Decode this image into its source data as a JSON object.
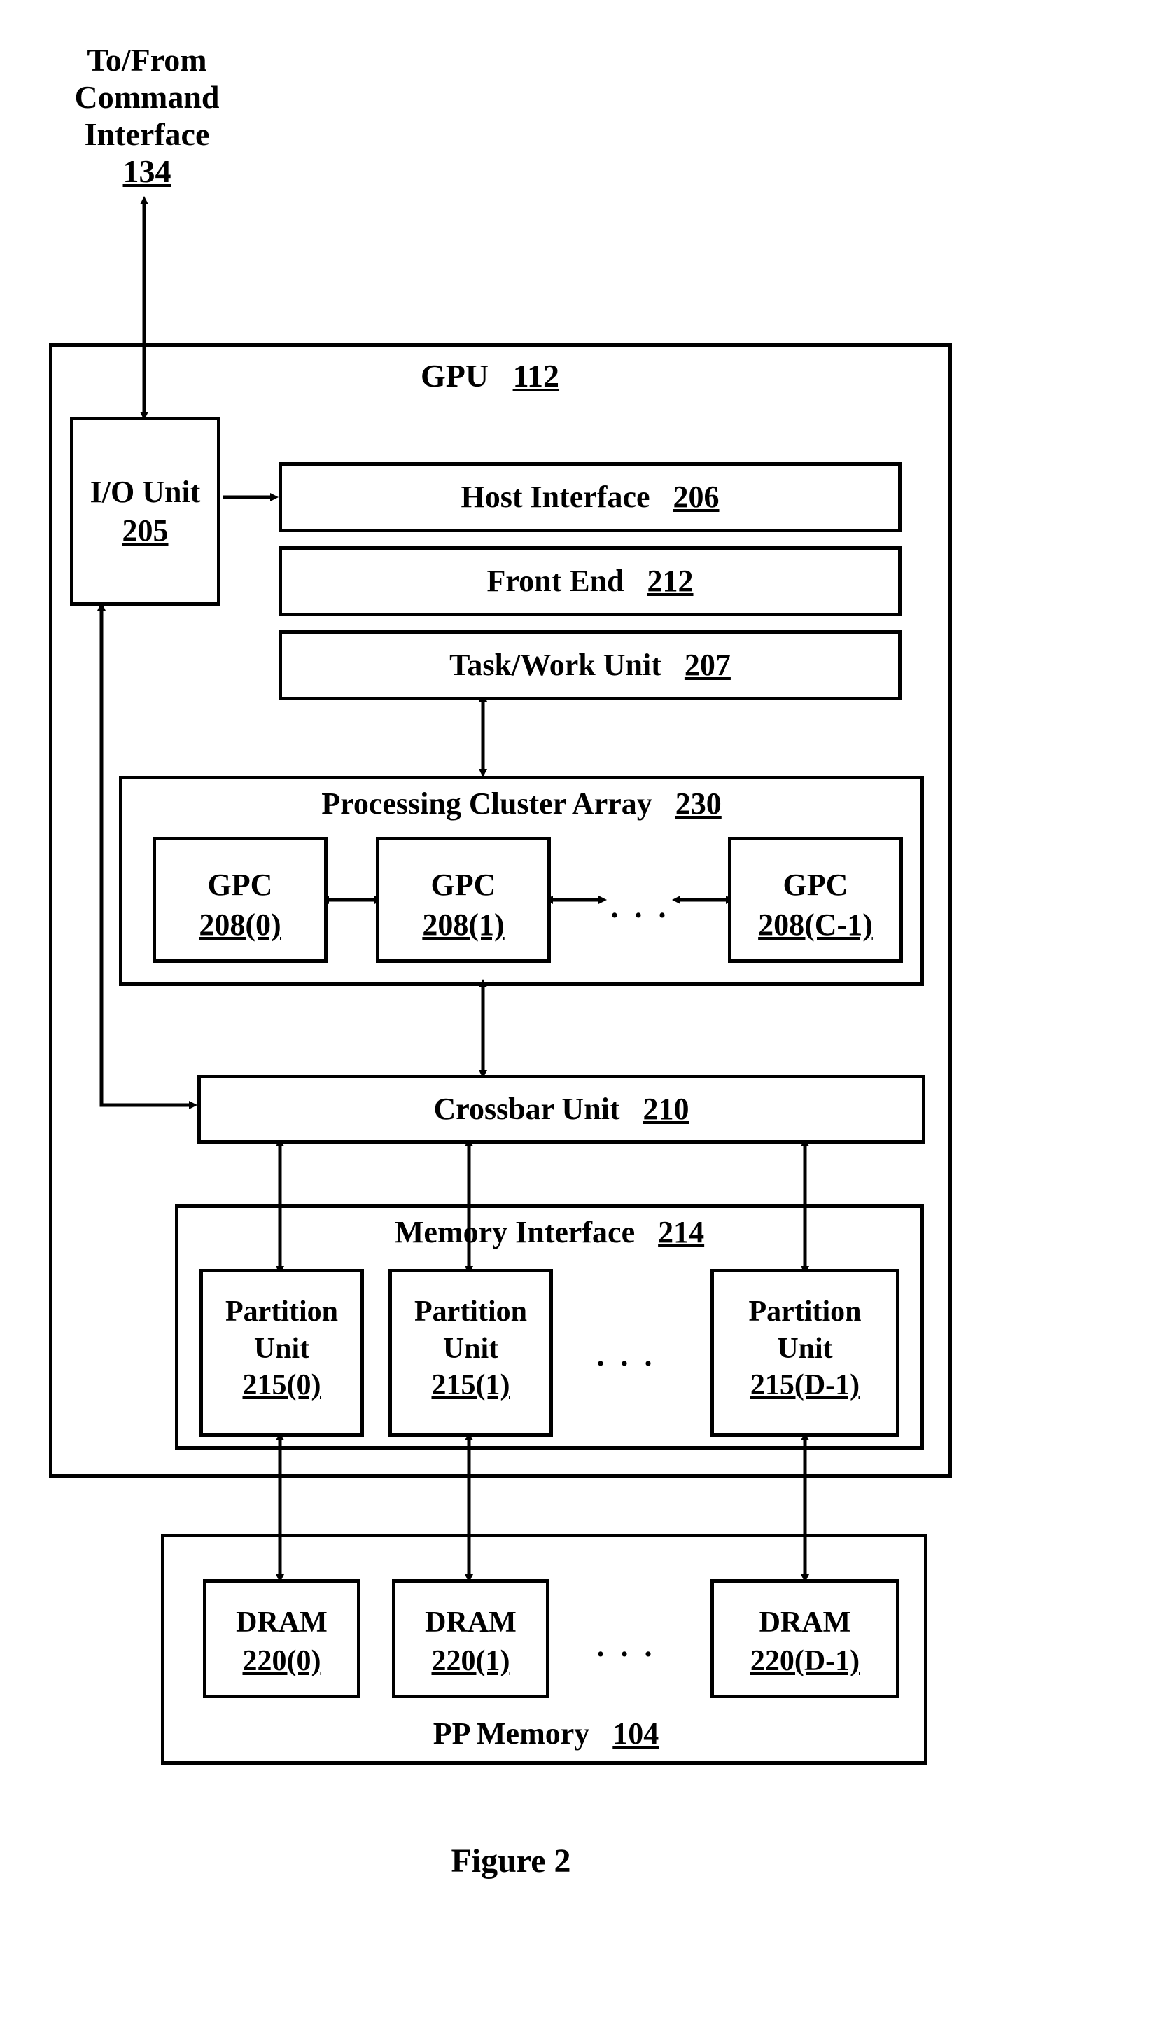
{
  "external": {
    "top_label_line1": "To/From",
    "top_label_line2": "Command",
    "top_label_line3": "Interface",
    "top_label_ref": "134"
  },
  "gpu": {
    "title": "GPU",
    "ref": "112",
    "io_unit": {
      "label": "I/O Unit",
      "ref": "205"
    },
    "host_interface": {
      "label": "Host Interface",
      "ref": "206"
    },
    "front_end": {
      "label": "Front End",
      "ref": "212"
    },
    "task_work_unit": {
      "label": "Task/Work Unit",
      "ref": "207"
    },
    "pca": {
      "title": "Processing Cluster Array",
      "ref": "230",
      "gpc": [
        {
          "label": "GPC",
          "ref": "208(0)"
        },
        {
          "label": "GPC",
          "ref": "208(1)"
        },
        {
          "label": "GPC",
          "ref": "208(C-1)"
        }
      ],
      "ellipsis": ". . ."
    },
    "crossbar": {
      "label": "Crossbar Unit",
      "ref": "210"
    },
    "mem_if": {
      "title": "Memory Interface",
      "ref": "214",
      "partition": [
        {
          "label_line1": "Partition",
          "label_line2": "Unit",
          "ref": "215(0)"
        },
        {
          "label_line1": "Partition",
          "label_line2": "Unit",
          "ref": "215(1)"
        },
        {
          "label_line1": "Partition",
          "label_line2": "Unit",
          "ref": "215(D-1)"
        }
      ],
      "ellipsis": ". . ."
    }
  },
  "pp_memory": {
    "title": "PP Memory",
    "ref": "104",
    "dram": [
      {
        "label": "DRAM",
        "ref": "220(0)"
      },
      {
        "label": "DRAM",
        "ref": "220(1)"
      },
      {
        "label": "DRAM",
        "ref": "220(D-1)"
      }
    ],
    "ellipsis": ". . ."
  },
  "figure_caption": "Figure 2"
}
